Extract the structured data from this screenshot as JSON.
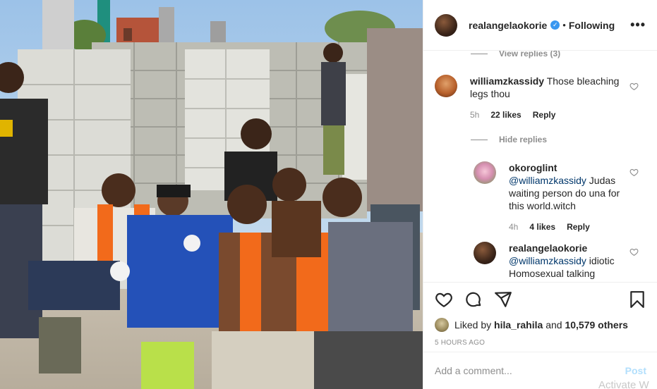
{
  "header": {
    "username": "realangelaokorie",
    "verified_symbol": "✓",
    "separator": "•",
    "follow_status": "Following",
    "more_icon": "more-horizontal-icon",
    "more_glyph": "•••"
  },
  "comments": {
    "view_replies_top": "View replies (3)",
    "items": [
      {
        "username": "williamzkassidy",
        "text": "Those bleaching legs thou",
        "time": "5h",
        "likes": "22 likes",
        "reply": "Reply",
        "toggle": "Hide replies"
      }
    ],
    "replies": [
      {
        "username": "okoroglint",
        "mention": "@williamzkassidy",
        "text": " Judas waiting person do una for this world.witch",
        "time": "4h",
        "likes": "4 likes",
        "reply": "Reply"
      },
      {
        "username": "realangelaokorie",
        "mention": "@williamzkassidy",
        "text": " idiotic Homosexual talking"
      }
    ]
  },
  "actions": {
    "like_icon": "heart-icon",
    "comment_icon": "comment-icon",
    "share_icon": "share-icon",
    "save_icon": "bookmark-icon",
    "liked_by_prefix": "Liked by",
    "liked_by_user": "hila_rahila",
    "liked_by_and": "and",
    "liked_by_others": "10,579 others",
    "timestamp": "5 HOURS AGO"
  },
  "add_comment": {
    "placeholder": "Add a comment...",
    "post_label": "Post"
  },
  "overlay": {
    "watermark": "Activate W"
  },
  "colors": {
    "accent": "#3897f0",
    "link": "#00376b",
    "muted": "#8e8e8e",
    "post_disabled": "#b2dffc",
    "vest_orange": "#f26a1b",
    "overall_blue": "#2451b8"
  }
}
